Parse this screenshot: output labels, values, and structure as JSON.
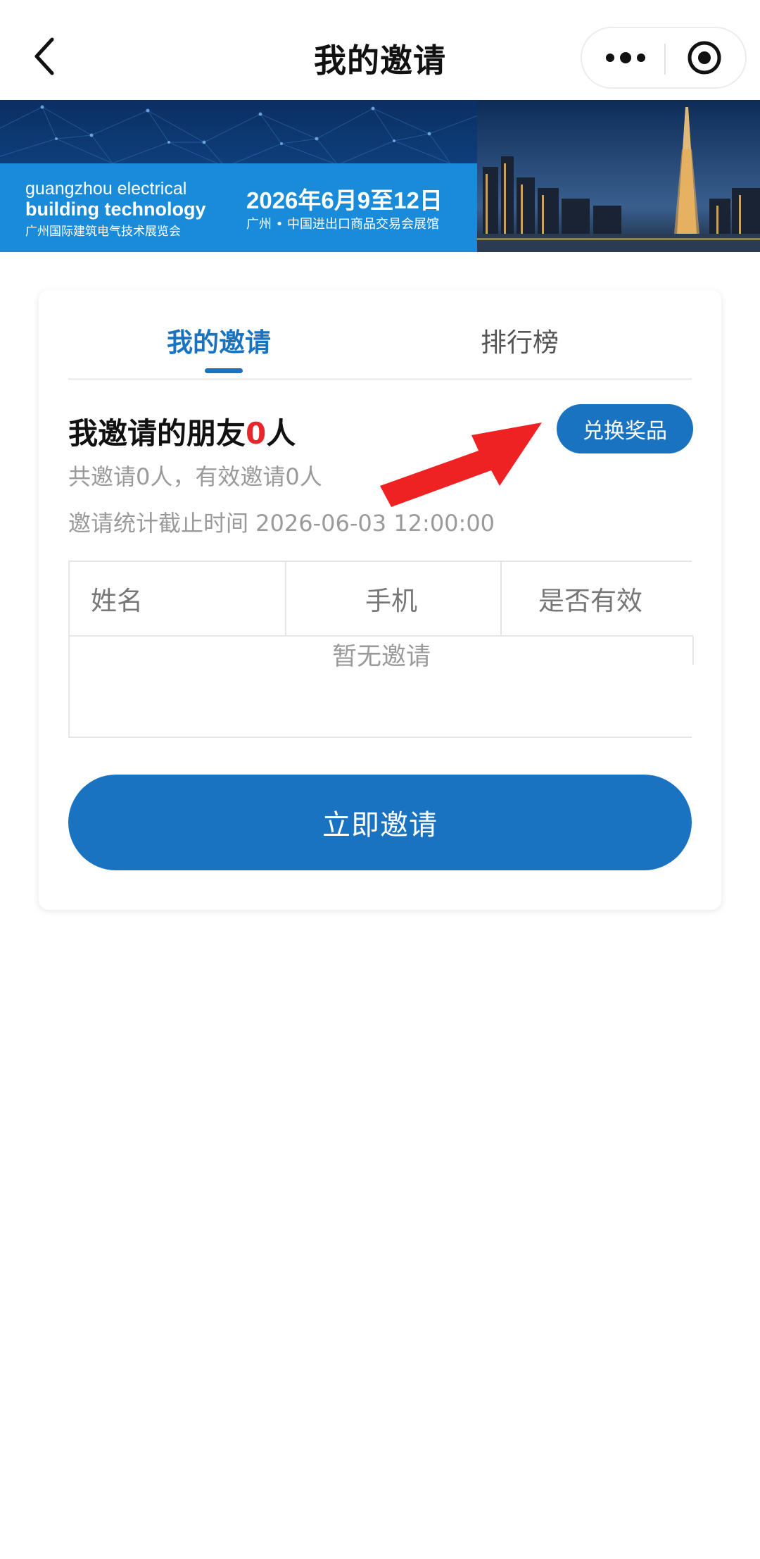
{
  "navbar": {
    "title": "我的邀请",
    "back_icon": "chevron-left-icon",
    "more_icon": "more-dots-icon",
    "close_icon": "target-circle-icon"
  },
  "banner": {
    "brand_en_line1": "guangzhou electrical",
    "brand_en_line2": "building technology",
    "brand_cn": "广州国际建筑电气技术展览会",
    "event_date": "2026年6月9至12日",
    "event_venue": "广州 • 中国进出口商品交易会展馆"
  },
  "tabs": {
    "my_invites": "我的邀请",
    "ranking": "排行榜",
    "active": "my_invites"
  },
  "summary": {
    "heading_prefix": "我邀请的朋友",
    "count": "0",
    "heading_suffix": "人",
    "totals": "共邀请0人，有效邀请0人",
    "cutoff": "邀请统计截止时间 2026-06-03 12:00:00",
    "redeem_button": "兑换奖品"
  },
  "table": {
    "columns": [
      "姓名",
      "手机",
      "是否有效"
    ],
    "rows": [],
    "empty_text": "暂无邀请"
  },
  "actions": {
    "invite_now": "立即邀请"
  },
  "colors": {
    "primary": "#1a73c0",
    "highlight": "#e8262b",
    "annotation_arrow": "#ee2222"
  }
}
